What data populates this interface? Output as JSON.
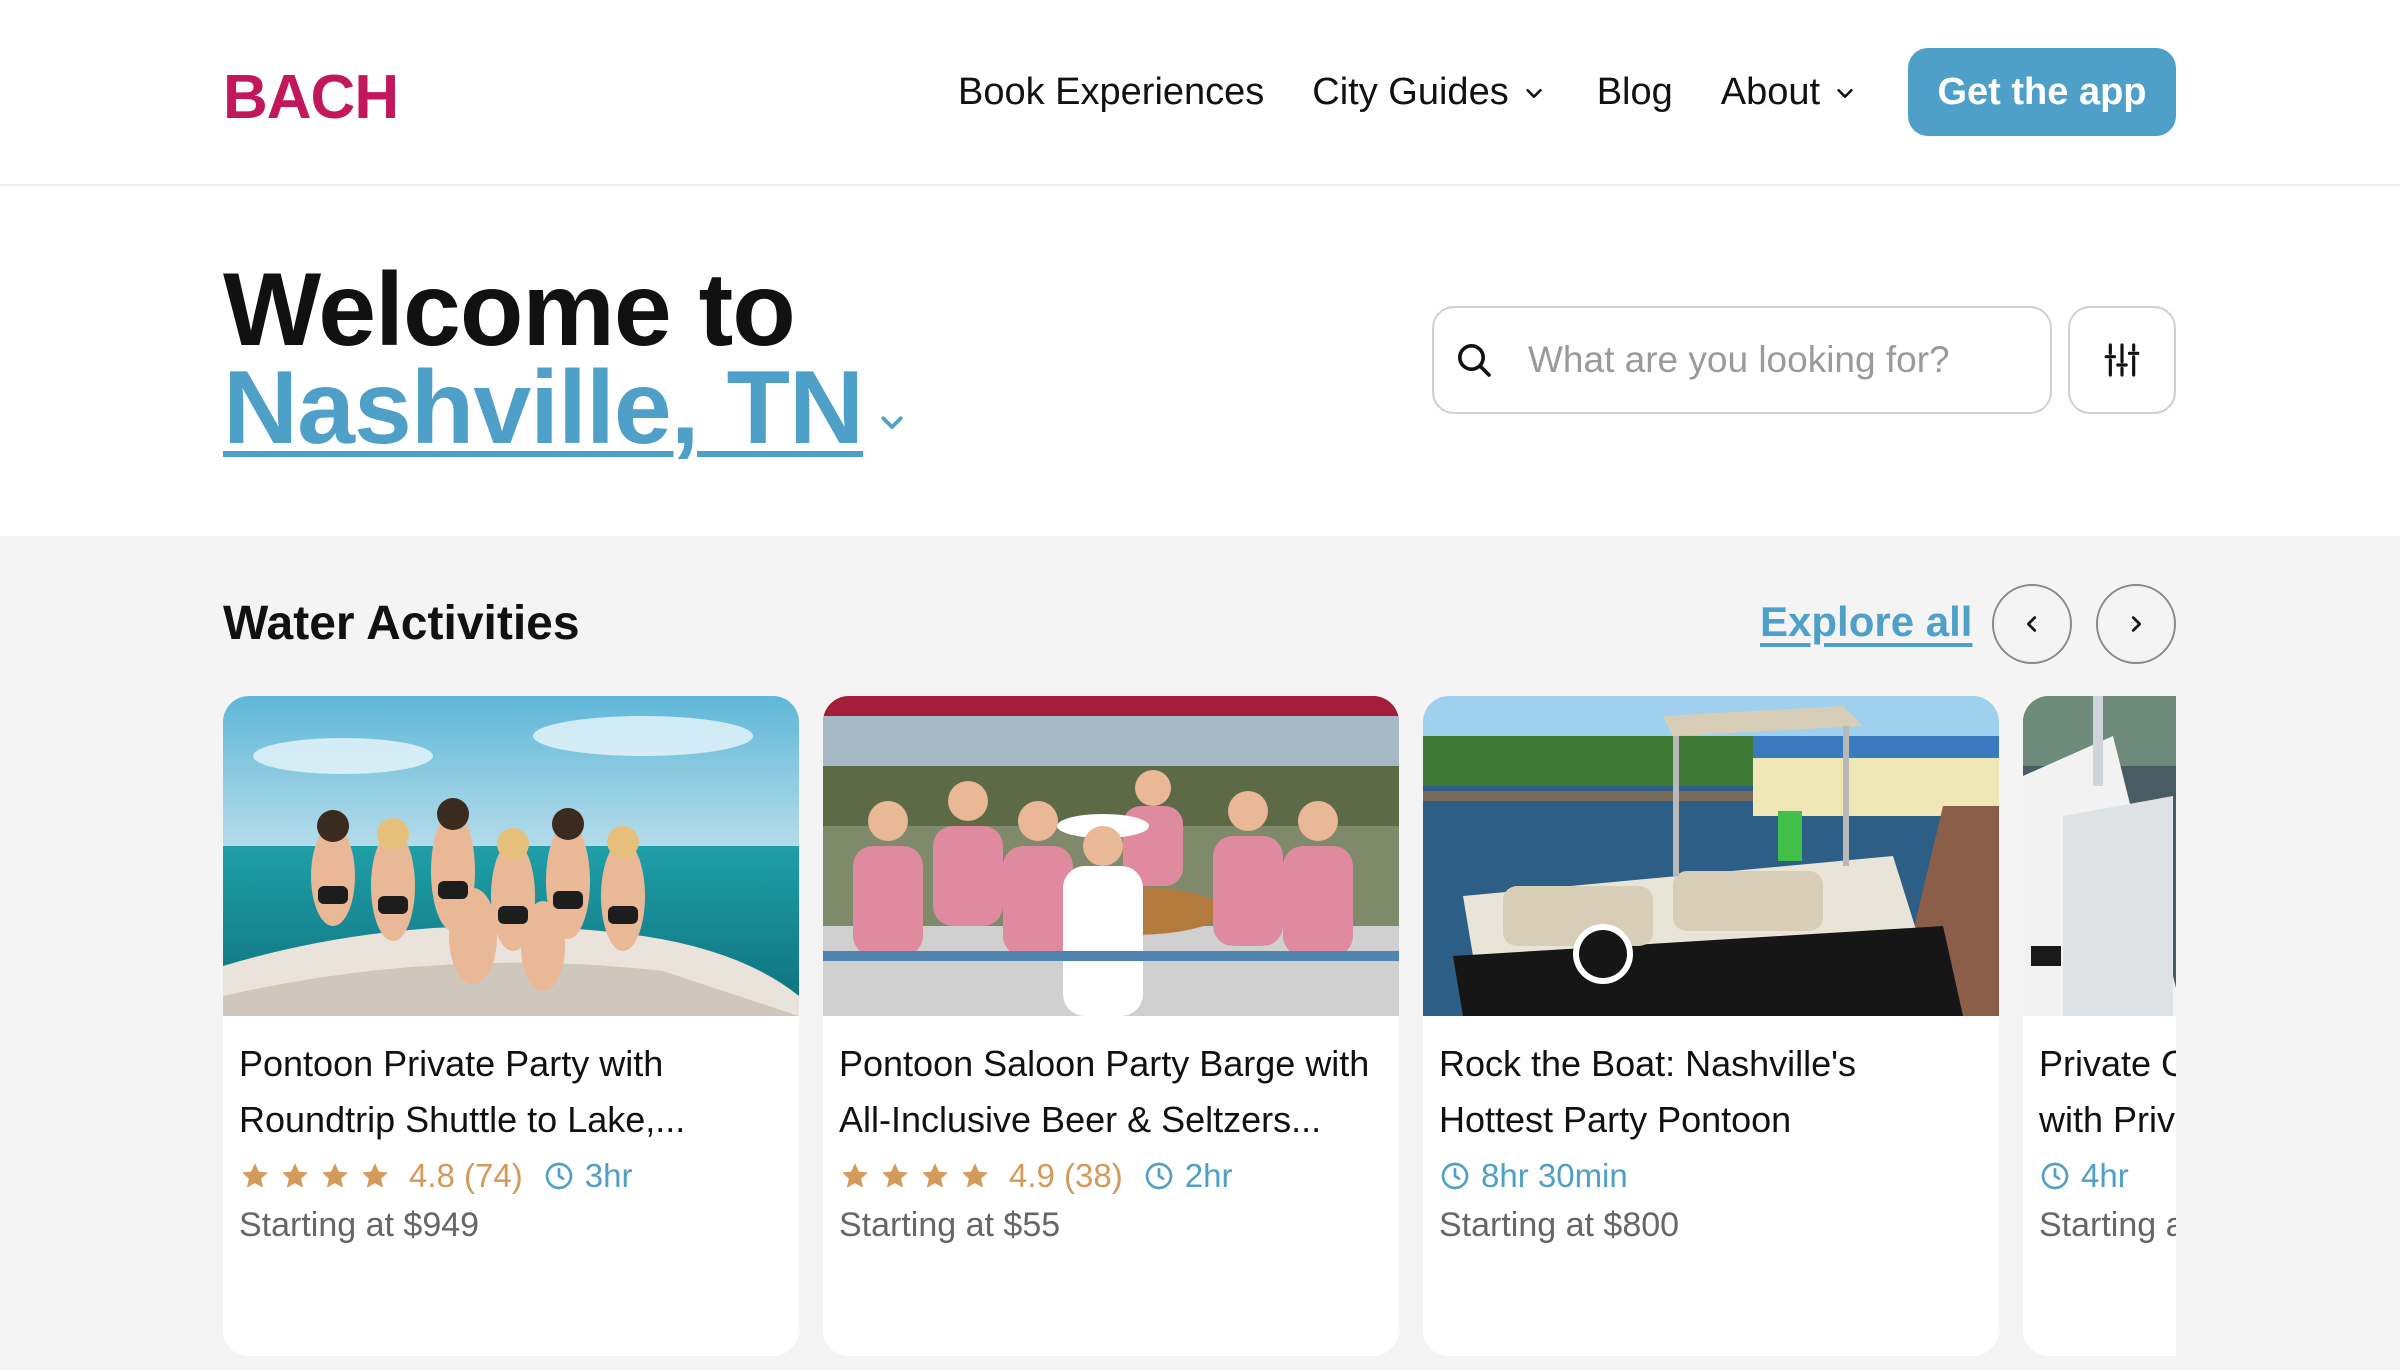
{
  "header": {
    "logo": "BACH",
    "nav": [
      {
        "label": "Book Experiences",
        "has_dropdown": false
      },
      {
        "label": "City Guides",
        "has_dropdown": true
      },
      {
        "label": "Blog",
        "has_dropdown": false
      },
      {
        "label": "About",
        "has_dropdown": true
      }
    ],
    "cta_label": "Get the app"
  },
  "hero": {
    "welcome": "Welcome to",
    "city": "Nashville, TN",
    "search_placeholder": "What are you looking for?",
    "filter_icon": "sliders-icon"
  },
  "section": {
    "title": "Water Activities",
    "explore_label": "Explore all",
    "prev_icon": "chevron-left-icon",
    "next_icon": "chevron-right-icon"
  },
  "cards": [
    {
      "title_line1": "Pontoon Private Party with",
      "title_line2": "Roundtrip Shuttle to Lake,...",
      "rating": "4.8 (74)",
      "stars": 4,
      "duration": "3hr",
      "price": "Starting at $949"
    },
    {
      "title_line1": "Pontoon Saloon Party Barge with",
      "title_line2": "All-Inclusive Beer & Seltzers...",
      "rating": "4.9 (38)",
      "stars": 4,
      "duration": "2hr",
      "price": "Starting at $55"
    },
    {
      "title_line1": "Rock the Boat: Nashville's",
      "title_line2": "Hottest Party Pontoon",
      "rating": "",
      "stars": 0,
      "duration": "8hr 30min",
      "price": "Starting at $800"
    },
    {
      "title_line1": "Private C",
      "title_line2": "with Priv",
      "rating": "",
      "stars": 0,
      "duration": "4hr",
      "price": "Starting a"
    }
  ],
  "colors": {
    "brand": "#c2185b",
    "accent": "#4fa0c8",
    "rating": "#d49a5a",
    "section_bg": "#f4f4f5"
  }
}
